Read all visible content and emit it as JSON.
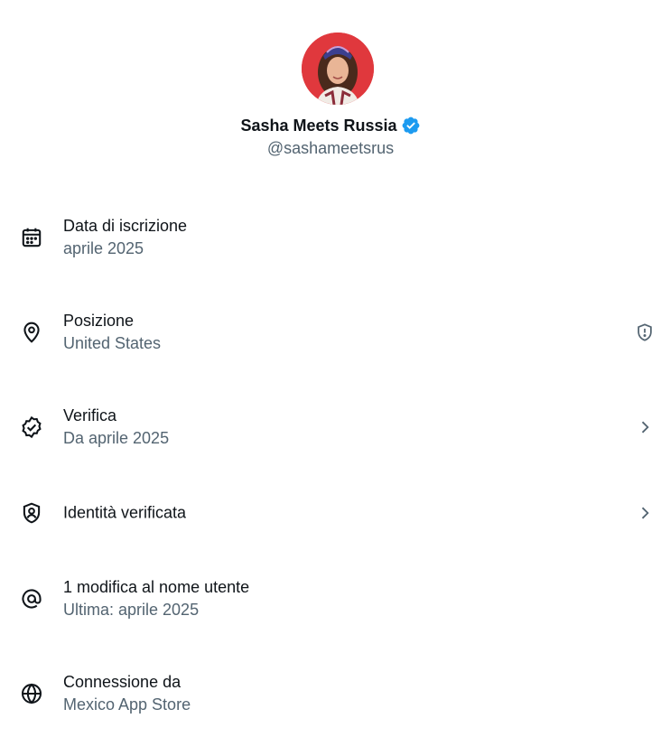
{
  "profile": {
    "display_name": "Sasha Meets Russia",
    "handle": "@sashameetsrus",
    "verified": true,
    "avatar_bg": "#e0383d"
  },
  "colors": {
    "text_primary": "#0f1419",
    "text_secondary": "#536471",
    "verified_blue": "#1d9bf0"
  },
  "rows": [
    {
      "icon": "calendar-icon",
      "title": "Data di iscrizione",
      "subtitle": "aprile 2025"
    },
    {
      "icon": "location-pin-icon",
      "title": "Posizione",
      "subtitle": "United States",
      "action": "shield-alert-icon"
    },
    {
      "icon": "verified-badge-icon",
      "title": "Verifica",
      "subtitle": "Da aprile 2025",
      "action": "chevron-right-icon"
    },
    {
      "icon": "id-shield-icon",
      "title": "Identità verificata",
      "action": "chevron-right-icon"
    },
    {
      "icon": "at-sign-icon",
      "title": "1 modifica al nome utente",
      "subtitle": "Ultima: aprile 2025"
    },
    {
      "icon": "globe-icon",
      "title": "Connessione da",
      "subtitle": "Mexico App Store"
    }
  ]
}
